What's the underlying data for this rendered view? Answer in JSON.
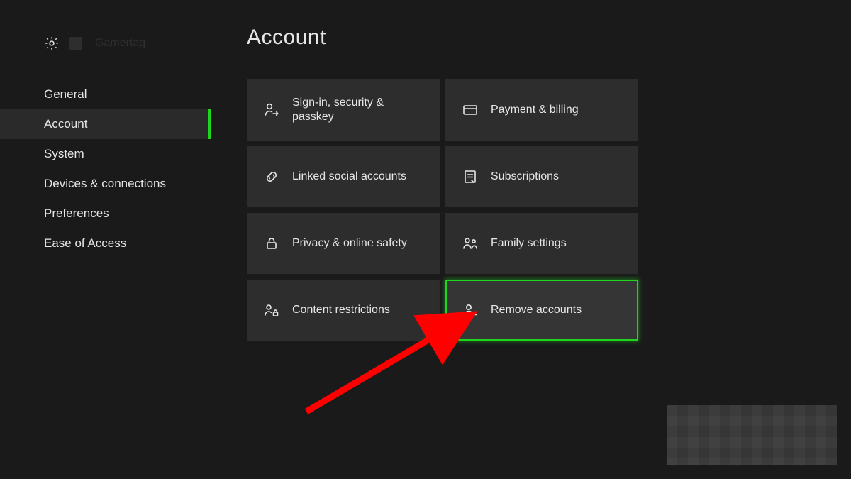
{
  "header": {
    "profile_name": "Gamertag"
  },
  "sidebar": {
    "items": [
      {
        "label": "General"
      },
      {
        "label": "Account"
      },
      {
        "label": "System"
      },
      {
        "label": "Devices & connections"
      },
      {
        "label": "Preferences"
      },
      {
        "label": "Ease of Access"
      }
    ],
    "selected_index": 1
  },
  "page": {
    "title": "Account"
  },
  "tiles": [
    {
      "icon": "person-arrow",
      "label": "Sign-in, security & passkey"
    },
    {
      "icon": "card",
      "label": "Payment & billing"
    },
    {
      "icon": "link",
      "label": "Linked social accounts"
    },
    {
      "icon": "receipt",
      "label": "Subscriptions"
    },
    {
      "icon": "lock",
      "label": "Privacy & online safety"
    },
    {
      "icon": "people",
      "label": "Family settings"
    },
    {
      "icon": "people-lock",
      "label": "Content restrictions"
    },
    {
      "icon": "person-minus",
      "label": "Remove accounts"
    }
  ],
  "highlighted_tile_index": 7,
  "colors": {
    "accent": "#1fd61f",
    "tile_bg": "#2d2d2d",
    "bg": "#1a1a1a",
    "annotation_arrow": "#ff0000"
  }
}
